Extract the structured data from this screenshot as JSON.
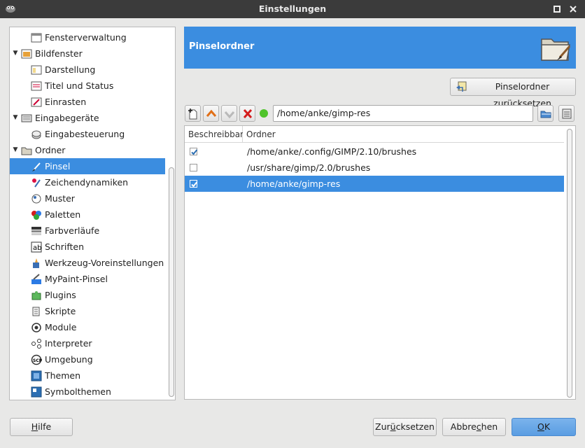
{
  "window": {
    "title": "Einstellungen"
  },
  "sidebar": {
    "items": [
      {
        "label": "Fensterverwaltung",
        "icon": "window-manager-icon",
        "level": 1,
        "expander": false
      },
      {
        "label": "Bildfenster",
        "icon": "image-window-icon",
        "level": 0,
        "expander": true
      },
      {
        "label": "Darstellung",
        "icon": "appearance-icon",
        "level": 1,
        "expander": false
      },
      {
        "label": "Titel und Status",
        "icon": "title-status-icon",
        "level": 1,
        "expander": false
      },
      {
        "label": "Einrasten",
        "icon": "snap-icon",
        "level": 1,
        "expander": false
      },
      {
        "label": "Eingabegeräte",
        "icon": "input-devices-icon",
        "level": 0,
        "expander": true
      },
      {
        "label": "Eingabesteuerung",
        "icon": "input-controllers-icon",
        "level": 1,
        "expander": false
      },
      {
        "label": "Ordner",
        "icon": "folder-icon",
        "level": 0,
        "expander": true
      },
      {
        "label": "Pinsel",
        "icon": "brush-icon",
        "level": 1,
        "expander": false,
        "selected": true
      },
      {
        "label": "Zeichendynamiken",
        "icon": "paint-dynamics-icon",
        "level": 1,
        "expander": false
      },
      {
        "label": "Muster",
        "icon": "pattern-icon",
        "level": 1,
        "expander": false
      },
      {
        "label": "Paletten",
        "icon": "palette-icon",
        "level": 1,
        "expander": false
      },
      {
        "label": "Farbverläufe",
        "icon": "gradient-icon",
        "level": 1,
        "expander": false
      },
      {
        "label": "Schriften",
        "icon": "font-icon",
        "level": 1,
        "expander": false
      },
      {
        "label": "Werkzeug-Voreinstellungen",
        "icon": "tool-presets-icon",
        "level": 1,
        "expander": false
      },
      {
        "label": "MyPaint-Pinsel",
        "icon": "mypaint-brush-icon",
        "level": 1,
        "expander": false
      },
      {
        "label": "Plugins",
        "icon": "plugin-icon",
        "level": 1,
        "expander": false
      },
      {
        "label": "Skripte",
        "icon": "script-icon",
        "level": 1,
        "expander": false
      },
      {
        "label": "Module",
        "icon": "module-icon",
        "level": 1,
        "expander": false
      },
      {
        "label": "Interpreter",
        "icon": "interpreter-icon",
        "level": 1,
        "expander": false
      },
      {
        "label": "Umgebung",
        "icon": "environment-icon",
        "level": 1,
        "expander": false
      },
      {
        "label": "Themen",
        "icon": "theme-icon",
        "level": 1,
        "expander": false
      },
      {
        "label": "Symbolthemen",
        "icon": "icon-theme-icon",
        "level": 1,
        "expander": false
      }
    ]
  },
  "banner": {
    "title": "Pinselordner",
    "icon": "folder-brush-icon"
  },
  "reset_folders_button": {
    "label": "Pinselordner zurücksetzen",
    "icon": "reset-icon"
  },
  "toolbar": {
    "buttons": [
      "new-folder-icon",
      "move-up-icon",
      "move-down-icon",
      "delete-icon"
    ],
    "status_icon": "valid-status-icon",
    "path_value": "/home/anke/gimp-res",
    "browse_icon": "browse-folder-icon",
    "filechooser_icon": "filechooser-icon"
  },
  "folder_list": {
    "columns": [
      "Beschreibbar",
      "Ordner"
    ],
    "rows": [
      {
        "writable": true,
        "path": "/home/anke/.config/GIMP/2.10/brushes",
        "selected": false
      },
      {
        "writable": false,
        "path": "/usr/share/gimp/2.0/brushes",
        "selected": false
      },
      {
        "writable": true,
        "path": "/home/anke/gimp-res",
        "selected": true
      }
    ]
  },
  "buttons": {
    "help": {
      "prefix": "",
      "mnemonic": "H",
      "suffix": "ilfe"
    },
    "reset": {
      "prefix": "Zur",
      "mnemonic": "ü",
      "suffix": "cksetzen"
    },
    "cancel": {
      "prefix": "Abbre",
      "mnemonic": "c",
      "suffix": "hen"
    },
    "ok": {
      "prefix": "",
      "mnemonic": "O",
      "suffix": "K"
    }
  },
  "colors": {
    "accent": "#3b8de0",
    "titlebar": "#3b3b3b",
    "status_green": "#4fc32b",
    "delete_red": "#d41c1c"
  }
}
